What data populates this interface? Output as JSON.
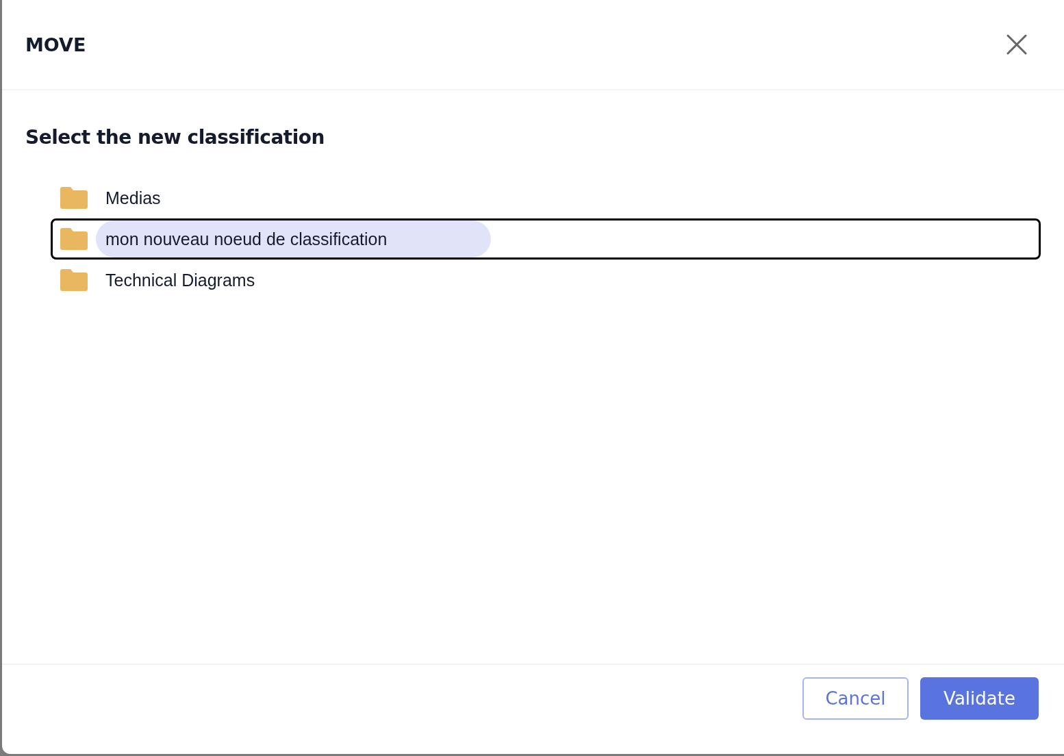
{
  "dialog": {
    "title": "MOVE",
    "subtitle": "Select the new classification"
  },
  "tree": {
    "items": [
      {
        "label": "Medias",
        "selected": false
      },
      {
        "label": "mon nouveau noeud de classification",
        "selected": true
      },
      {
        "label": "Technical Diagrams",
        "selected": false
      }
    ]
  },
  "buttons": [
    {
      "label": "Cancel",
      "kind": "secondary"
    },
    {
      "label": "Validate",
      "kind": "primary"
    }
  ]
}
